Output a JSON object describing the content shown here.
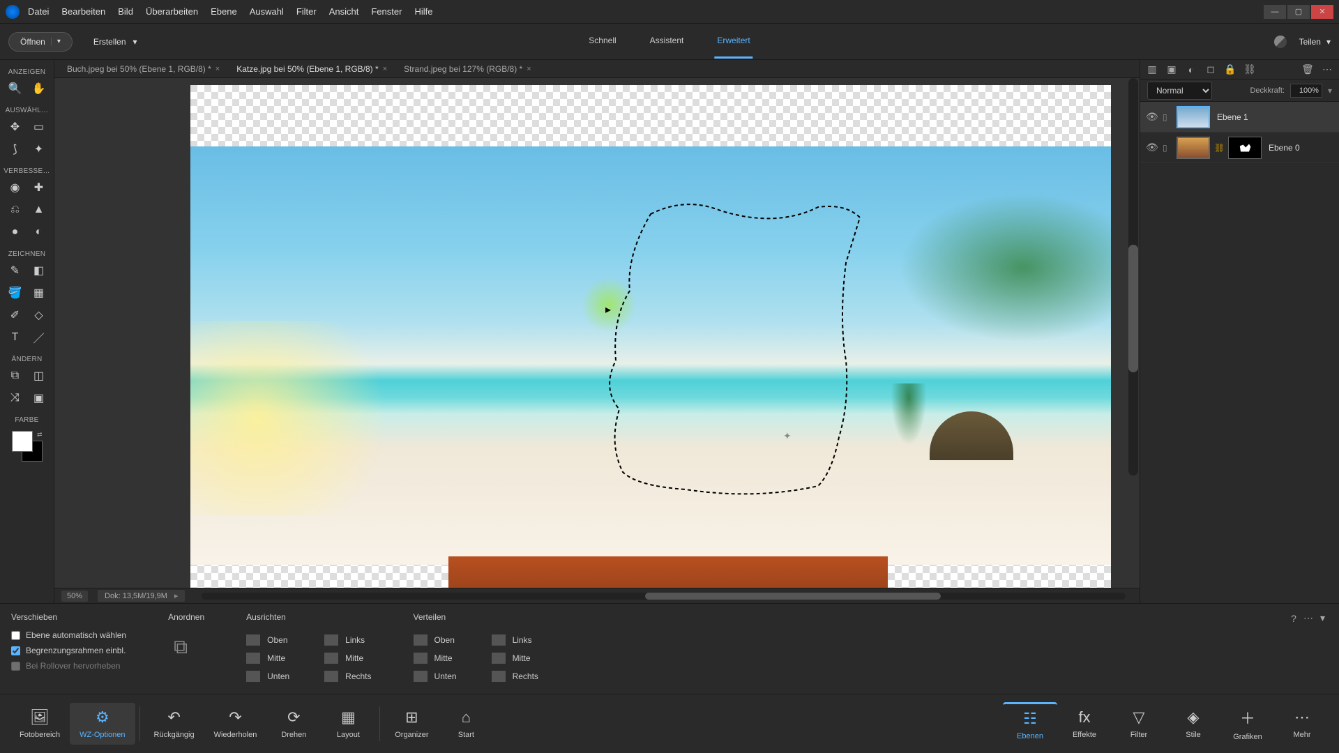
{
  "menu": {
    "items": [
      "Datei",
      "Bearbeiten",
      "Bild",
      "Überarbeiten",
      "Ebene",
      "Auswahl",
      "Filter",
      "Ansicht",
      "Fenster",
      "Hilfe"
    ]
  },
  "toolbar": {
    "open": "Öffnen",
    "create": "Erstellen",
    "share": "Teilen"
  },
  "modes": {
    "quick": "Schnell",
    "guided": "Assistent",
    "expert": "Erweitert"
  },
  "tabs": [
    {
      "label": "Buch.jpeg bei 50% (Ebene 1, RGB/8) *"
    },
    {
      "label": "Katze.jpg bei 50% (Ebene 1, RGB/8) *"
    },
    {
      "label": "Strand.jpeg bei 127% (RGB/8) *"
    }
  ],
  "sections": {
    "view": "ANZEIGEN",
    "select": "AUSWÄHL…",
    "enhance": "VERBESSE…",
    "draw": "ZEICHNEN",
    "modify": "ÄNDERN",
    "color": "FARBE"
  },
  "status": {
    "zoom": "50%",
    "doc": "Dok: 13,5M/19,9M"
  },
  "blend": {
    "mode": "Normal",
    "opacity_label": "Deckkraft:",
    "opacity": "100%"
  },
  "layers": [
    {
      "name": "Ebene 1"
    },
    {
      "name": "Ebene 0"
    }
  ],
  "options": {
    "tool": "Verschieben",
    "auto_select": "Ebene automatisch wählen",
    "bounding": "Begrenzungsrahmen einbl.",
    "rollover": "Bei Rollover hervorheben",
    "arrange": "Anordnen",
    "align": "Ausrichten",
    "distribute": "Verteilen",
    "top": "Oben",
    "middle": "Mitte",
    "bottom": "Unten",
    "left": "Links",
    "center": "Mitte",
    "right": "Rechts"
  },
  "bottom": {
    "photobin": "Fotobereich",
    "tooloptions": "WZ-Optionen",
    "undo": "Rückgängig",
    "redo": "Wiederholen",
    "rotate": "Drehen",
    "layout": "Layout",
    "organizer": "Organizer",
    "home": "Start",
    "layers": "Ebenen",
    "effects": "Effekte",
    "filter": "Filter",
    "styles": "Stile",
    "graphics": "Grafiken",
    "more": "Mehr"
  }
}
